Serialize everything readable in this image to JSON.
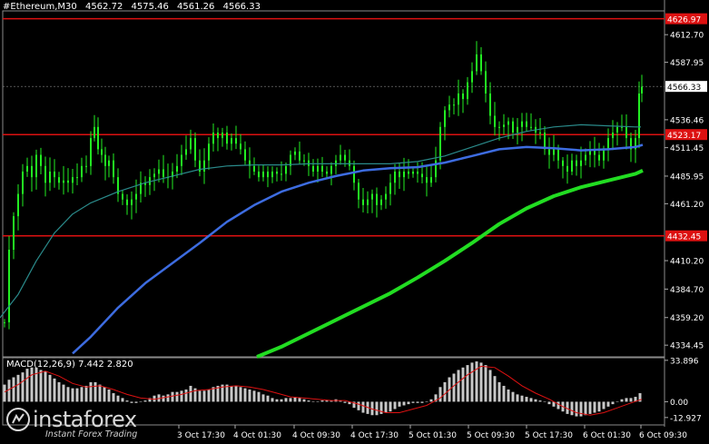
{
  "header": {
    "symbol": "#Ethereum,M30",
    "open": "4562.72",
    "high": "4575.46",
    "low": "4561.26",
    "close": "4566.33"
  },
  "colors": {
    "background": "#000000",
    "candles": "#22ee22",
    "sma_slow": "#22dd22",
    "sma_mid": "#3d6ce0",
    "sma_fast": "#2a8a8a",
    "level_lines": "#dd1111",
    "macd_hist": "#c8c8c8",
    "macd_signal": "#dd1111"
  },
  "watermark": {
    "name": "instaforex",
    "tagline": "Instant Forex Trading"
  },
  "macd": {
    "label": "MACD(12,26,9) 7.442 2.820",
    "ylim": [
      -19.0,
      36.0
    ],
    "axis_labels": [
      "33.896",
      "0.00",
      "-12.927"
    ]
  },
  "chart_data": {
    "type": "candlestick",
    "title": "#Ethereum,M30",
    "ylim": [
      4324.0,
      4634.0
    ],
    "y_tick_labels": [
      "4612.70",
      "4587.95",
      "4536.46",
      "4511.45",
      "4485.95",
      "4461.20",
      "4410.20",
      "4384.70",
      "4359.20",
      "4334.45"
    ],
    "x_tick_labels": [
      "3 Oct 17:30",
      "4 Oct 01:30",
      "4 Oct 09:30",
      "4 Oct 17:30",
      "5 Oct 01:30",
      "5 Oct 09:30",
      "5 Oct 17:30",
      "6 Oct 01:30",
      "6 Oct 09:30"
    ],
    "horizontal_levels": [
      {
        "value": 4626.97,
        "label": "4626.97"
      },
      {
        "value": 4523.17,
        "label": "4523.17"
      },
      {
        "value": 4432.45,
        "label": "4432.45"
      }
    ],
    "current_price": {
      "value": 4566.33,
      "label": "4566.33"
    },
    "moving_averages": [
      {
        "series": "sma_fast",
        "values": [
          [
            0,
            4359
          ],
          [
            20,
            4380
          ],
          [
            40,
            4410
          ],
          [
            60,
            4435
          ],
          [
            80,
            4452
          ],
          [
            100,
            4462
          ],
          [
            130,
            4472
          ],
          [
            160,
            4480
          ],
          [
            190,
            4486
          ],
          [
            220,
            4492
          ],
          [
            250,
            4495
          ],
          [
            280,
            4496
          ],
          [
            310,
            4496
          ],
          [
            340,
            4497
          ],
          [
            370,
            4497
          ],
          [
            400,
            4497
          ],
          [
            430,
            4497
          ],
          [
            460,
            4499
          ],
          [
            490,
            4504
          ],
          [
            520,
            4512
          ],
          [
            550,
            4520
          ],
          [
            580,
            4526
          ],
          [
            610,
            4530
          ],
          [
            640,
            4532
          ],
          [
            670,
            4531
          ],
          [
            700,
            4530
          ],
          [
            706,
            4530
          ]
        ]
      },
      {
        "series": "sma_mid",
        "values": [
          [
            80,
            4327
          ],
          [
            100,
            4342
          ],
          [
            130,
            4368
          ],
          [
            160,
            4390
          ],
          [
            190,
            4408
          ],
          [
            220,
            4426
          ],
          [
            250,
            4445
          ],
          [
            280,
            4460
          ],
          [
            310,
            4472
          ],
          [
            340,
            4480
          ],
          [
            370,
            4486
          ],
          [
            400,
            4491
          ],
          [
            430,
            4493
          ],
          [
            460,
            4494
          ],
          [
            490,
            4498
          ],
          [
            520,
            4504
          ],
          [
            550,
            4510
          ],
          [
            580,
            4512
          ],
          [
            610,
            4511
          ],
          [
            640,
            4509
          ],
          [
            670,
            4510
          ],
          [
            700,
            4512
          ],
          [
            708,
            4514
          ]
        ]
      },
      {
        "series": "sma_slow",
        "values": [
          [
            283,
            4324
          ],
          [
            310,
            4333
          ],
          [
            340,
            4345
          ],
          [
            370,
            4357
          ],
          [
            400,
            4369
          ],
          [
            430,
            4381
          ],
          [
            460,
            4395
          ],
          [
            490,
            4410
          ],
          [
            520,
            4426
          ],
          [
            550,
            4443
          ],
          [
            580,
            4457
          ],
          [
            610,
            4468
          ],
          [
            640,
            4476
          ],
          [
            670,
            4482
          ],
          [
            700,
            4488
          ],
          [
            708,
            4491
          ]
        ]
      }
    ],
    "candles_ohlc_approx": "generated series following the visible price path",
    "price_path": [
      [
        5,
        4355
      ],
      [
        10,
        4420
      ],
      [
        15,
        4450
      ],
      [
        20,
        4470
      ],
      [
        25,
        4490
      ],
      [
        30,
        4495
      ],
      [
        35,
        4485
      ],
      [
        40,
        4505
      ],
      [
        45,
        4495
      ],
      [
        50,
        4480
      ],
      [
        55,
        4490
      ],
      [
        60,
        4485
      ],
      [
        65,
        4480
      ],
      [
        70,
        4482
      ],
      [
        75,
        4480
      ],
      [
        80,
        4485
      ],
      [
        85,
        4485
      ],
      [
        90,
        4495
      ],
      [
        95,
        4495
      ],
      [
        100,
        4520
      ],
      [
        104,
        4530
      ],
      [
        108,
        4510
      ],
      [
        112,
        4505
      ],
      [
        116,
        4495
      ],
      [
        120,
        4500
      ],
      [
        125,
        4485
      ],
      [
        130,
        4470
      ],
      [
        135,
        4465
      ],
      [
        140,
        4460
      ],
      [
        145,
        4465
      ],
      [
        150,
        4470
      ],
      [
        155,
        4480
      ],
      [
        160,
        4478
      ],
      [
        165,
        4485
      ],
      [
        170,
        4488
      ],
      [
        175,
        4492
      ],
      [
        180,
        4485
      ],
      [
        185,
        4485
      ],
      [
        190,
        4490
      ],
      [
        195,
        4495
      ],
      [
        200,
        4505
      ],
      [
        205,
        4510
      ],
      [
        210,
        4520
      ],
      [
        215,
        4500
      ],
      [
        220,
        4490
      ],
      [
        225,
        4500
      ],
      [
        230,
        4515
      ],
      [
        235,
        4525
      ],
      [
        240,
        4520
      ],
      [
        245,
        4525
      ],
      [
        250,
        4515
      ],
      [
        255,
        4520
      ],
      [
        260,
        4515
      ],
      [
        265,
        4510
      ],
      [
        270,
        4500
      ],
      [
        275,
        4495
      ],
      [
        280,
        4490
      ],
      [
        285,
        4485
      ],
      [
        290,
        4490
      ],
      [
        295,
        4485
      ],
      [
        300,
        4490
      ],
      [
        305,
        4488
      ],
      [
        310,
        4488
      ],
      [
        315,
        4495
      ],
      [
        320,
        4505
      ],
      [
        325,
        4508
      ],
      [
        330,
        4500
      ],
      [
        335,
        4500
      ],
      [
        340,
        4495
      ],
      [
        345,
        4490
      ],
      [
        350,
        4495
      ],
      [
        355,
        4490
      ],
      [
        360,
        4488
      ],
      [
        365,
        4495
      ],
      [
        370,
        4500
      ],
      [
        375,
        4505
      ],
      [
        380,
        4500
      ],
      [
        385,
        4495
      ],
      [
        390,
        4480
      ],
      [
        395,
        4465
      ],
      [
        400,
        4460
      ],
      [
        405,
        4465
      ],
      [
        410,
        4470
      ],
      [
        415,
        4460
      ],
      [
        420,
        4465
      ],
      [
        425,
        4470
      ],
      [
        430,
        4480
      ],
      [
        435,
        4490
      ],
      [
        440,
        4485
      ],
      [
        445,
        4490
      ],
      [
        450,
        4488
      ],
      [
        455,
        4490
      ],
      [
        460,
        4488
      ],
      [
        465,
        4485
      ],
      [
        470,
        4480
      ],
      [
        475,
        4485
      ],
      [
        480,
        4500
      ],
      [
        485,
        4530
      ],
      [
        490,
        4545
      ],
      [
        495,
        4550
      ],
      [
        500,
        4550
      ],
      [
        505,
        4560
      ],
      [
        510,
        4555
      ],
      [
        515,
        4570
      ],
      [
        520,
        4580
      ],
      [
        525,
        4595
      ],
      [
        530,
        4580
      ],
      [
        535,
        4560
      ],
      [
        540,
        4540
      ],
      [
        545,
        4530
      ],
      [
        550,
        4530
      ],
      [
        555,
        4532
      ],
      [
        560,
        4535
      ],
      [
        565,
        4525
      ],
      [
        570,
        4530
      ],
      [
        575,
        4535
      ],
      [
        580,
        4530
      ],
      [
        585,
        4530
      ],
      [
        590,
        4525
      ],
      [
        595,
        4525
      ],
      [
        600,
        4510
      ],
      [
        605,
        4505
      ],
      [
        610,
        4510
      ],
      [
        615,
        4500
      ],
      [
        620,
        4495
      ],
      [
        625,
        4490
      ],
      [
        630,
        4500
      ],
      [
        635,
        4495
      ],
      [
        640,
        4500
      ],
      [
        645,
        4505
      ],
      [
        650,
        4510
      ],
      [
        655,
        4505
      ],
      [
        660,
        4500
      ],
      [
        665,
        4510
      ],
      [
        670,
        4520
      ],
      [
        675,
        4525
      ],
      [
        680,
        4530
      ],
      [
        685,
        4530
      ],
      [
        690,
        4520
      ],
      [
        695,
        4510
      ],
      [
        700,
        4520
      ],
      [
        704,
        4560
      ],
      [
        707,
        4566
      ]
    ],
    "macd_histogram": [
      [
        5,
        14
      ],
      [
        10,
        18
      ],
      [
        15,
        20
      ],
      [
        20,
        22
      ],
      [
        25,
        24
      ],
      [
        30,
        27
      ],
      [
        35,
        28
      ],
      [
        40,
        28
      ],
      [
        45,
        26
      ],
      [
        50,
        25
      ],
      [
        55,
        22
      ],
      [
        60,
        19
      ],
      [
        65,
        16
      ],
      [
        70,
        14
      ],
      [
        75,
        12
      ],
      [
        80,
        11
      ],
      [
        85,
        11
      ],
      [
        90,
        12
      ],
      [
        95,
        13
      ],
      [
        100,
        16
      ],
      [
        105,
        16
      ],
      [
        110,
        14
      ],
      [
        115,
        12
      ],
      [
        120,
        10
      ],
      [
        125,
        7
      ],
      [
        130,
        5
      ],
      [
        135,
        3
      ],
      [
        140,
        1
      ],
      [
        145,
        -1
      ],
      [
        150,
        -1
      ],
      [
        155,
        0
      ],
      [
        160,
        1
      ],
      [
        165,
        3
      ],
      [
        170,
        5
      ],
      [
        175,
        6
      ],
      [
        180,
        5
      ],
      [
        185,
        6
      ],
      [
        190,
        8
      ],
      [
        195,
        8
      ],
      [
        200,
        9
      ],
      [
        205,
        10
      ],
      [
        210,
        13
      ],
      [
        215,
        11
      ],
      [
        220,
        9
      ],
      [
        225,
        9
      ],
      [
        230,
        10
      ],
      [
        235,
        12
      ],
      [
        240,
        13
      ],
      [
        245,
        14
      ],
      [
        250,
        14
      ],
      [
        255,
        13
      ],
      [
        260,
        13
      ],
      [
        265,
        12
      ],
      [
        270,
        11
      ],
      [
        275,
        10
      ],
      [
        280,
        9
      ],
      [
        285,
        8
      ],
      [
        290,
        6
      ],
      [
        295,
        5
      ],
      [
        300,
        3
      ],
      [
        305,
        2
      ],
      [
        310,
        2
      ],
      [
        315,
        3
      ],
      [
        320,
        3
      ],
      [
        325,
        4
      ],
      [
        330,
        3
      ],
      [
        335,
        2
      ],
      [
        340,
        1
      ],
      [
        345,
        0
      ],
      [
        350,
        0
      ],
      [
        355,
        1
      ],
      [
        360,
        1
      ],
      [
        365,
        1
      ],
      [
        370,
        2
      ],
      [
        375,
        1
      ],
      [
        380,
        -1
      ],
      [
        385,
        -2
      ],
      [
        390,
        -5
      ],
      [
        395,
        -7
      ],
      [
        400,
        -9
      ],
      [
        405,
        -10
      ],
      [
        410,
        -11
      ],
      [
        415,
        -11
      ],
      [
        420,
        -10
      ],
      [
        425,
        -9
      ],
      [
        430,
        -8
      ],
      [
        435,
        -6
      ],
      [
        440,
        -4
      ],
      [
        445,
        -3
      ],
      [
        450,
        -2
      ],
      [
        455,
        -1
      ],
      [
        460,
        -1
      ],
      [
        465,
        -1
      ],
      [
        470,
        0
      ],
      [
        475,
        2
      ],
      [
        480,
        6
      ],
      [
        485,
        12
      ],
      [
        490,
        16
      ],
      [
        495,
        20
      ],
      [
        500,
        23
      ],
      [
        505,
        26
      ],
      [
        510,
        28
      ],
      [
        515,
        30
      ],
      [
        520,
        32
      ],
      [
        525,
        33
      ],
      [
        530,
        32
      ],
      [
        535,
        30
      ],
      [
        540,
        26
      ],
      [
        545,
        21
      ],
      [
        550,
        16
      ],
      [
        555,
        13
      ],
      [
        560,
        10
      ],
      [
        565,
        8
      ],
      [
        570,
        6
      ],
      [
        575,
        5
      ],
      [
        580,
        4
      ],
      [
        585,
        3
      ],
      [
        590,
        2
      ],
      [
        595,
        1
      ],
      [
        600,
        0
      ],
      [
        605,
        -2
      ],
      [
        610,
        -4
      ],
      [
        615,
        -6
      ],
      [
        620,
        -8
      ],
      [
        625,
        -10
      ],
      [
        630,
        -11
      ],
      [
        635,
        -12
      ],
      [
        640,
        -12
      ],
      [
        645,
        -11
      ],
      [
        650,
        -10
      ],
      [
        655,
        -9
      ],
      [
        660,
        -8
      ],
      [
        665,
        -6
      ],
      [
        670,
        -4
      ],
      [
        675,
        -2
      ],
      [
        680,
        0
      ],
      [
        685,
        2
      ],
      [
        690,
        3
      ],
      [
        695,
        3
      ],
      [
        700,
        4
      ],
      [
        705,
        7
      ]
    ],
    "macd_signal": [
      [
        5,
        8
      ],
      [
        20,
        14
      ],
      [
        35,
        22
      ],
      [
        50,
        25
      ],
      [
        65,
        21
      ],
      [
        80,
        15
      ],
      [
        95,
        12
      ],
      [
        110,
        13
      ],
      [
        125,
        10
      ],
      [
        140,
        6
      ],
      [
        155,
        3
      ],
      [
        170,
        2
      ],
      [
        185,
        4
      ],
      [
        200,
        6
      ],
      [
        215,
        9
      ],
      [
        230,
        10
      ],
      [
        245,
        12
      ],
      [
        260,
        13
      ],
      [
        275,
        12
      ],
      [
        290,
        10
      ],
      [
        305,
        7
      ],
      [
        320,
        4
      ],
      [
        335,
        3
      ],
      [
        350,
        2
      ],
      [
        365,
        1
      ],
      [
        380,
        1
      ],
      [
        395,
        -2
      ],
      [
        410,
        -6
      ],
      [
        425,
        -9
      ],
      [
        440,
        -9
      ],
      [
        455,
        -6
      ],
      [
        470,
        -3
      ],
      [
        485,
        3
      ],
      [
        500,
        13
      ],
      [
        515,
        22
      ],
      [
        530,
        29
      ],
      [
        545,
        28
      ],
      [
        560,
        21
      ],
      [
        575,
        13
      ],
      [
        590,
        7
      ],
      [
        605,
        2
      ],
      [
        620,
        -4
      ],
      [
        635,
        -9
      ],
      [
        650,
        -11
      ],
      [
        665,
        -9
      ],
      [
        680,
        -5
      ],
      [
        695,
        -1
      ],
      [
        707,
        2
      ]
    ]
  }
}
